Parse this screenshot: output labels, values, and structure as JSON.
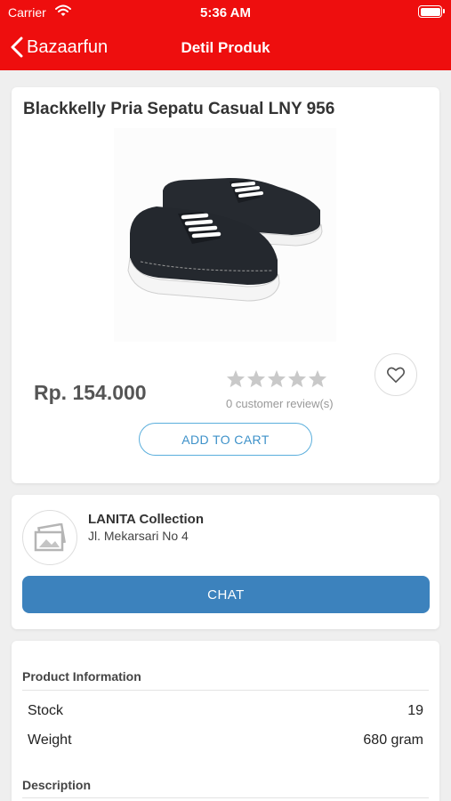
{
  "status_bar": {
    "carrier": "Carrier",
    "time": "5:36 AM"
  },
  "nav": {
    "back_label": "Bazaarfun",
    "title": "Detil Produk"
  },
  "product": {
    "title": "Blackkelly Pria Sepatu Casual LNY 956",
    "image_icon": "sneaker-product-photo",
    "price": "Rp. 154.000",
    "rating": 0,
    "reviews_text": "0 customer review(s)",
    "add_to_cart_label": "ADD TO CART",
    "wishlist_icon": "heart-icon"
  },
  "store": {
    "name": "LANITA Collection",
    "address": "Jl. Mekarsari No 4",
    "logo_icon": "image-placeholder-icon",
    "chat_label": "CHAT"
  },
  "info": {
    "product_info_heading": "Product Information",
    "rows": [
      {
        "label": "Stock",
        "value": "19"
      },
      {
        "label": "Weight",
        "value": "680 gram"
      }
    ],
    "description_heading": "Description"
  },
  "colors": {
    "brand_red": "#ee0e0e",
    "chat_blue": "#3c82bd",
    "cart_outline": "#5aaedc"
  }
}
